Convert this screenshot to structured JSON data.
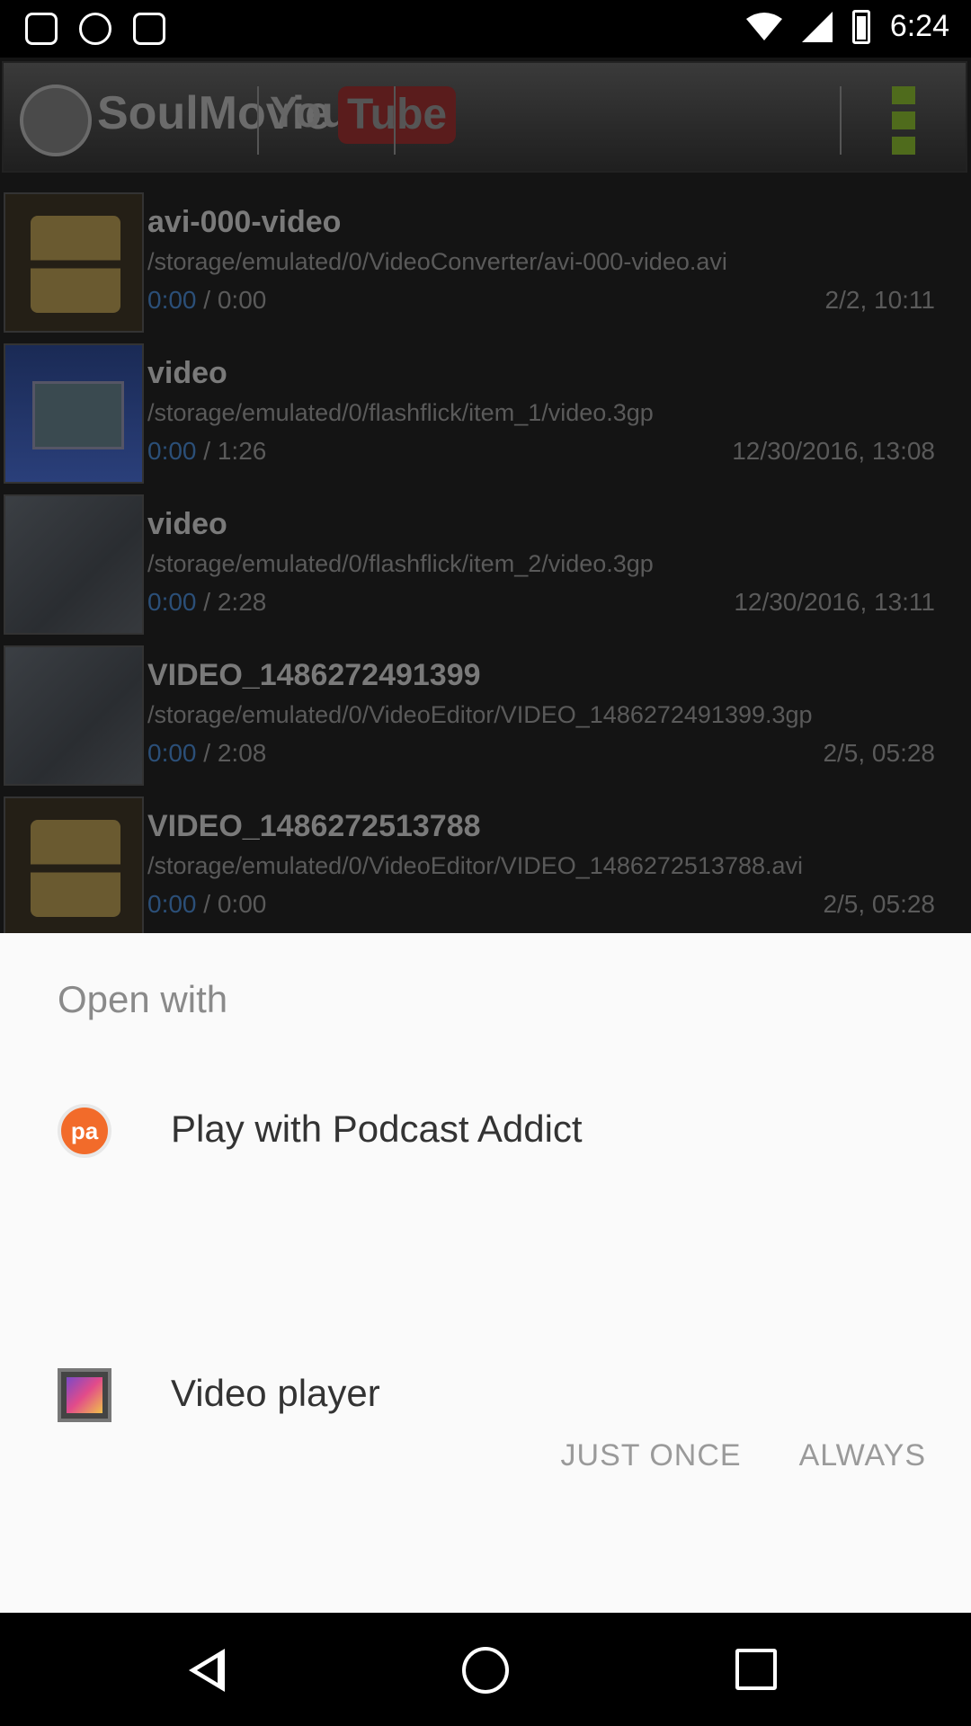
{
  "status_bar": {
    "time": "6:24",
    "icons": [
      "lock-icon",
      "clock-icon",
      "android-icon",
      "wifi-icon",
      "signal-icon",
      "battery-icon"
    ]
  },
  "app_bar": {
    "logo_text": "SoulMovie",
    "yt_you": "You",
    "yt_tube": "Tube"
  },
  "videos": [
    {
      "title": "avi-000-video",
      "path": "/storage/emulated/0/VideoConverter/avi-000-video.avi",
      "position": "0:00",
      "duration": " / 0:00",
      "date": "2/2, 10:11",
      "thumb": "film"
    },
    {
      "title": "video",
      "path": "/storage/emulated/0/flashflick/item_1/video.3gp",
      "position": "0:00",
      "duration": " / 1:26",
      "date": "12/30/2016, 13:08",
      "thumb": "blue"
    },
    {
      "title": "video",
      "path": "/storage/emulated/0/flashflick/item_2/video.3gp",
      "position": "0:00",
      "duration": " / 2:28",
      "date": "12/30/2016, 13:11",
      "thumb": "snow"
    },
    {
      "title": "VIDEO_1486272491399",
      "path": "/storage/emulated/0/VideoEditor/VIDEO_1486272491399.3gp",
      "position": "0:00",
      "duration": " / 2:08",
      "date": "2/5, 05:28",
      "thumb": "snow"
    },
    {
      "title": "VIDEO_1486272513788",
      "path": "/storage/emulated/0/VideoEditor/VIDEO_1486272513788.avi",
      "position": "0:00",
      "duration": " / 0:00",
      "date": "2/5, 05:28",
      "thumb": "film"
    }
  ],
  "sheet": {
    "title": "Open with",
    "options": [
      {
        "label": "Play with Podcast Addict",
        "icon": "podcast-addict-icon"
      },
      {
        "label": "Video player",
        "icon": "video-player-icon"
      }
    ],
    "just_once": "JUST ONCE",
    "always": "ALWAYS"
  },
  "nav": {
    "icons": [
      "back-icon",
      "home-icon",
      "recents-icon"
    ]
  }
}
